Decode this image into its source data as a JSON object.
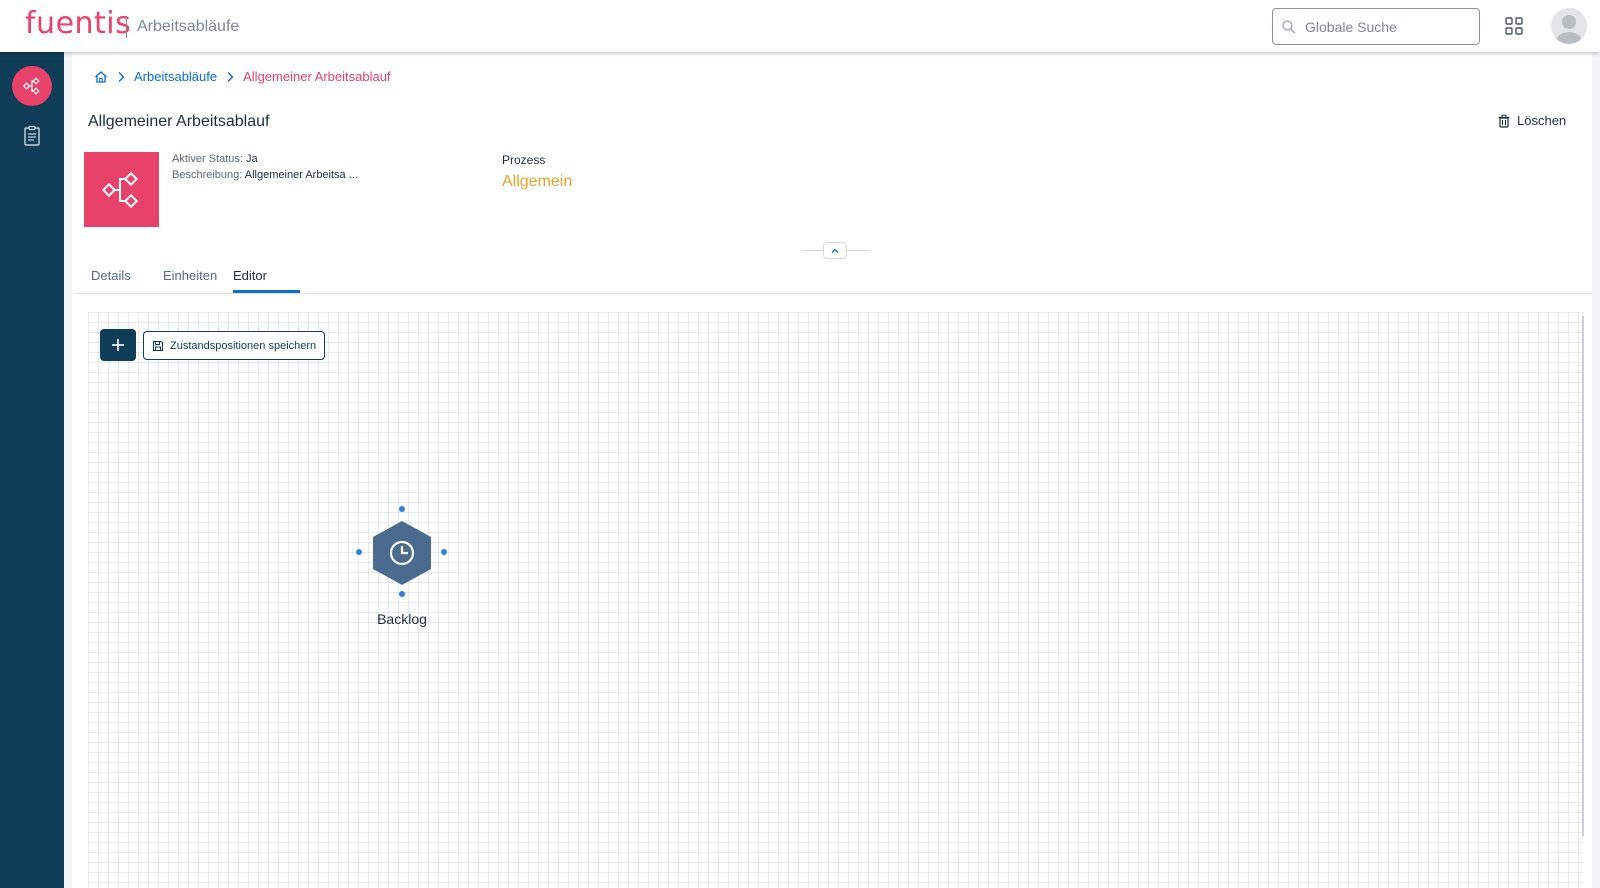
{
  "header": {
    "logo_text": "fuentis",
    "app_title": "Arbeitsabläufe",
    "search_placeholder": "Globale Suche"
  },
  "sidebar": {
    "items": [
      {
        "icon": "workflow-icon",
        "active": true
      },
      {
        "icon": "clipboard-icon",
        "active": false
      }
    ]
  },
  "breadcrumb": {
    "link": "Arbeitsabläufe",
    "current": "Allgemeiner Arbeitsablauf"
  },
  "page": {
    "title": "Allgemeiner Arbeitsablauf",
    "delete_label": "Löschen"
  },
  "object_header": {
    "status_label": "Aktiver Status:",
    "status_value": "Ja",
    "description_label": "Beschreibung:",
    "description_value": "Allgemeiner Arbeitsa ...",
    "process_label": "Prozess",
    "process_value": "Allgemein"
  },
  "tabs": [
    {
      "label": "Details",
      "selected": false
    },
    {
      "label": "Einheiten",
      "selected": false
    },
    {
      "label": "Editor",
      "selected": true
    }
  ],
  "editor": {
    "save_positions_label": "Zustandspositionen speichern",
    "nodes": [
      {
        "label": "Backlog",
        "icon": "clock-icon"
      }
    ]
  },
  "colors": {
    "accent": "#e8416a",
    "sidebar": "#0f3c56",
    "link": "#0a6ed1",
    "process": "#e8a32a",
    "node": "#4a6b8d"
  }
}
